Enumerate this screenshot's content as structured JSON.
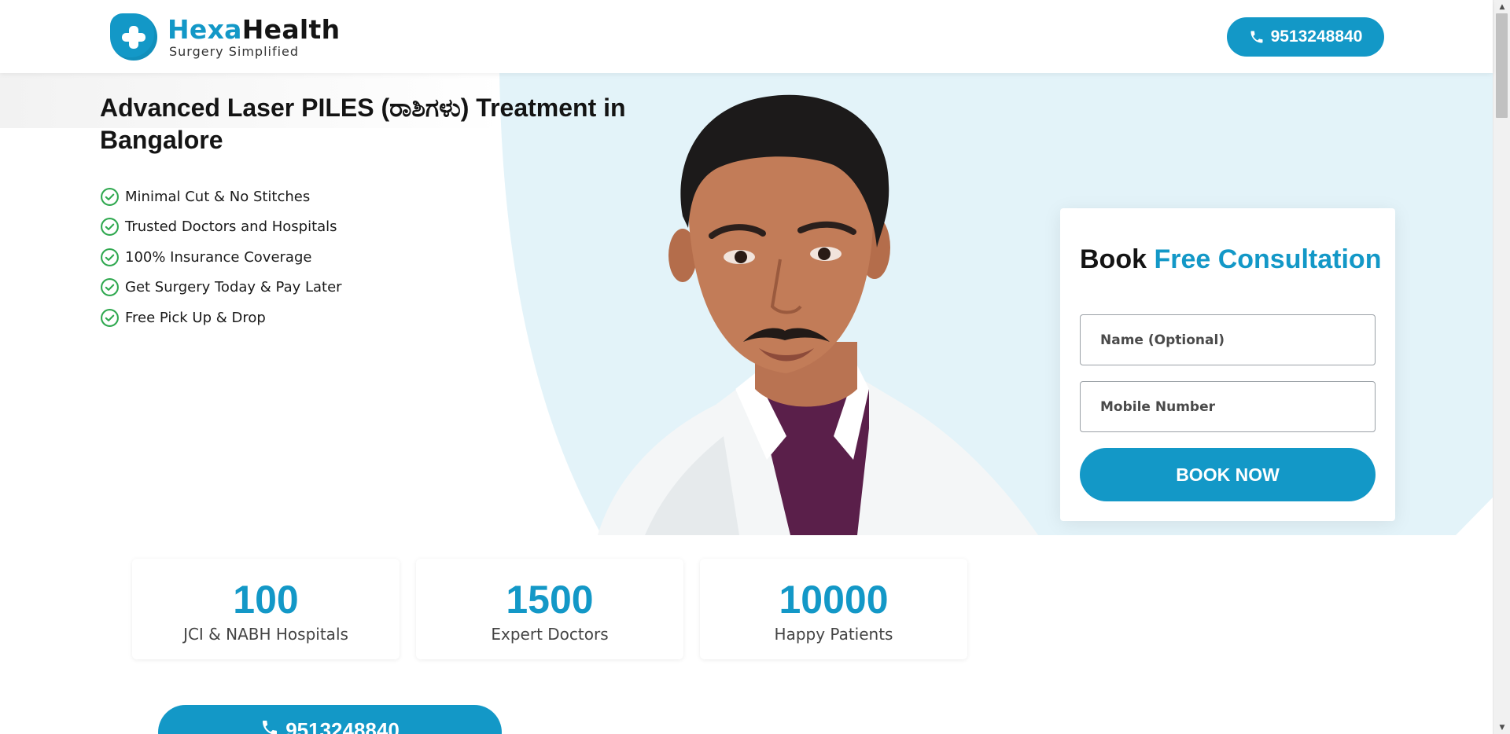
{
  "header": {
    "brand_part1": "Hexa",
    "brand_part2": "Health",
    "tagline": "Surgery Simplified",
    "phone": "9513248840"
  },
  "hero": {
    "title": "Advanced Laser PILES (ರಾಶಿಗಳು) Treatment in Bangalore",
    "benefits": [
      "Minimal Cut & No Stitches",
      "Trusted Doctors and Hospitals",
      "100% Insurance Coverage",
      "Get Surgery Today & Pay Later",
      "Free Pick Up & Drop"
    ]
  },
  "form": {
    "title_part1": "Book",
    "title_part2": "Free Consultation",
    "name_placeholder": "Name (Optional)",
    "mobile_placeholder": "Mobile Number",
    "submit_label": "BOOK NOW"
  },
  "stats": [
    {
      "value": "100",
      "label": "JCI & NABH Hospitals"
    },
    {
      "value": "1500",
      "label": "Expert Doctors"
    },
    {
      "value": "10000",
      "label": "Happy Patients"
    }
  ],
  "cta": {
    "phone": "9513248840"
  },
  "colors": {
    "accent": "#1398c7",
    "check_green": "#2fa84f",
    "hero_bg": "#e3f3f9",
    "text_dark": "#141414"
  },
  "icons": {
    "logo": "medical-cross-icon",
    "phone": "phone-icon",
    "check": "check-circle-icon"
  }
}
